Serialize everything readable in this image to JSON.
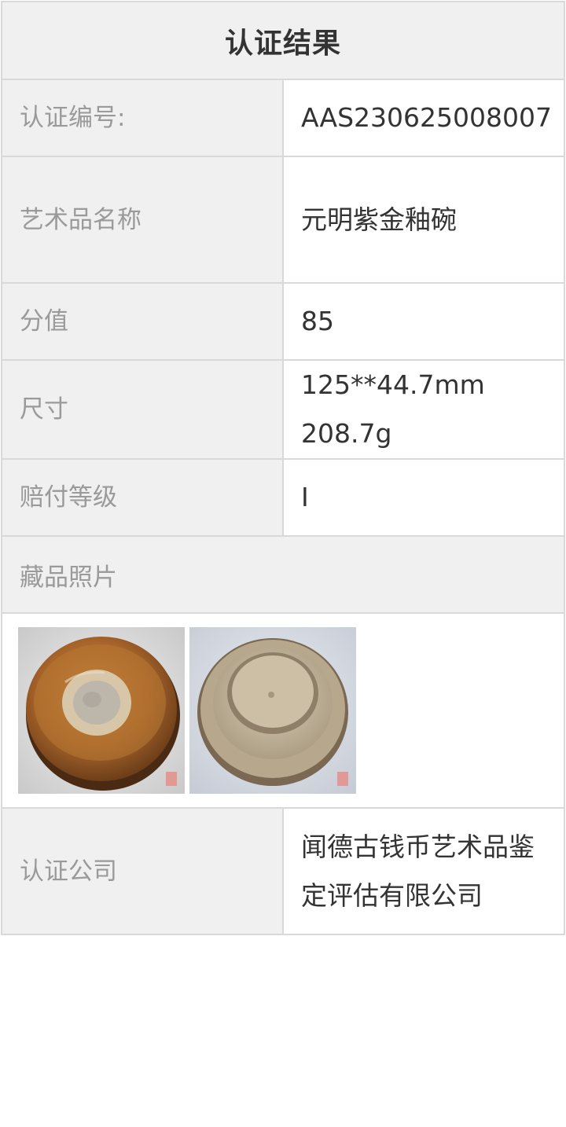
{
  "header": {
    "title": "认证结果"
  },
  "rows": [
    {
      "label": "认证编号:",
      "value": "AAS230625008007"
    },
    {
      "label": "艺术品名称",
      "value": "元明紫金釉碗"
    },
    {
      "label": "分值",
      "value": "85"
    },
    {
      "label": "尺寸",
      "value": "125**44.7mm 208.7g"
    },
    {
      "label": "赔付等级",
      "value": "I"
    }
  ],
  "photos_section": {
    "label": "藏品照片",
    "photos": [
      {
        "icon": "bowl-interior-photo"
      },
      {
        "icon": "bowl-base-photo"
      }
    ]
  },
  "company": {
    "label": "认证公司",
    "value": "闻德古钱币艺术品鉴定评估有限公司"
  },
  "colors": {
    "label_bg": "#f0f0f0",
    "border": "#d9d9d9",
    "label_text": "#9a9a9a",
    "value_text": "#333333"
  }
}
